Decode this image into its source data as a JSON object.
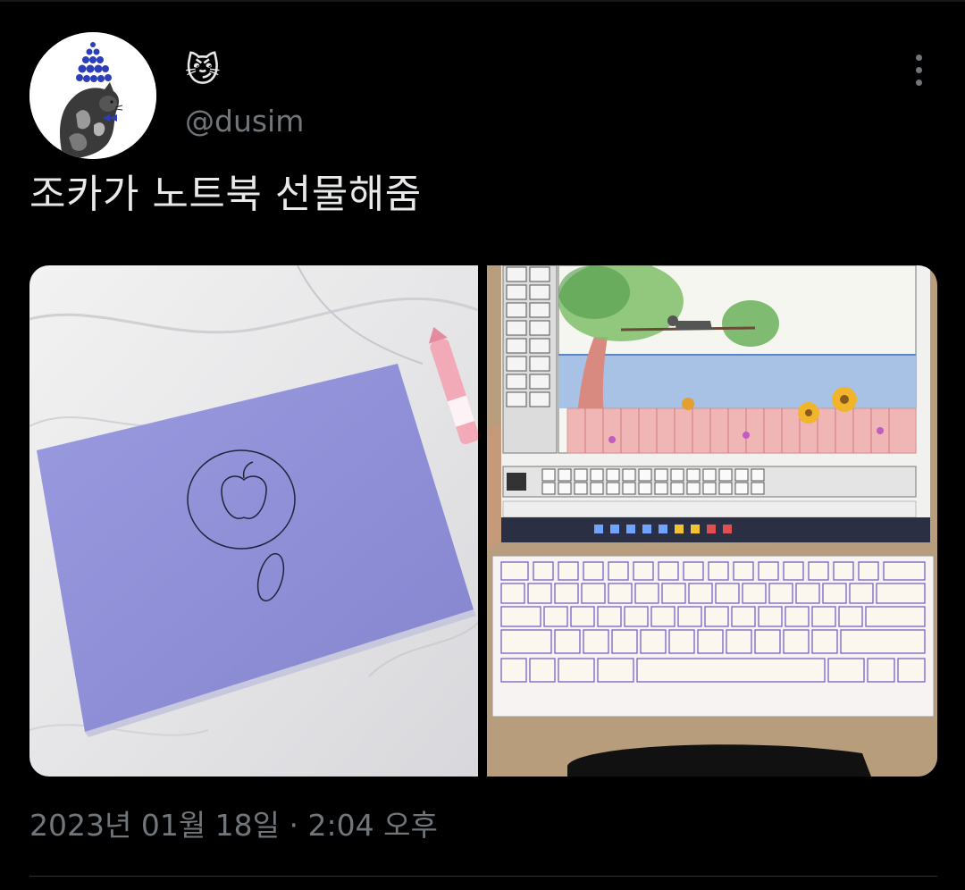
{
  "author": {
    "display_name": "😼",
    "handle": "@dusim"
  },
  "tweet": {
    "text": "조카가 노트북 선물해줌",
    "timestamp": "2023년 01월 18일 · 2:04 오후"
  },
  "icons": {
    "more": "more-vertical-icon"
  },
  "colors": {
    "background": "#000000",
    "primary_text": "#e7e9ea",
    "secondary_text": "#71767b",
    "notebook_cover": "#8f8fd8"
  }
}
